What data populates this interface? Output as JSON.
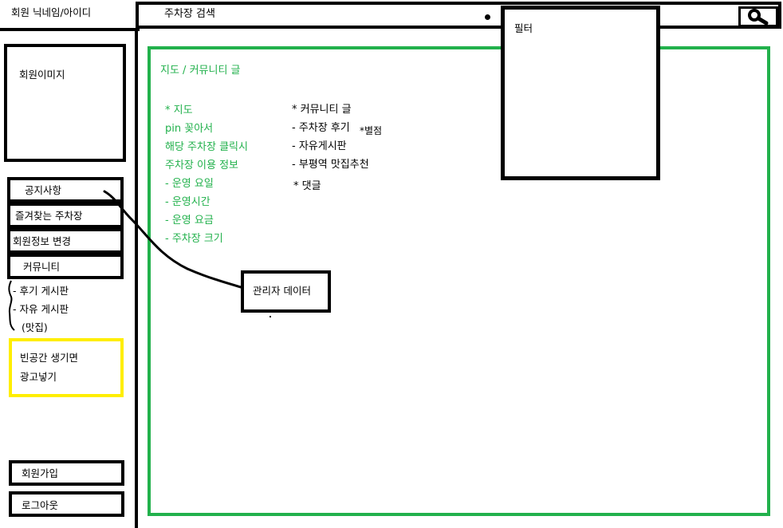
{
  "header": {
    "nickname": "회원 닉네임/아이디",
    "search_placeholder": "주차장 검색",
    "filter_label": "필터"
  },
  "sidebar": {
    "member_image": "회원이미지",
    "nav": [
      "공지사항",
      "즐겨찾는 주차장",
      "회원정보 변경",
      "커뮤니티"
    ],
    "community_sub": [
      "- 후기 게시판",
      "- 자유 게시판",
      "(맛집)"
    ],
    "ad": [
      "빈공간 생기면",
      "광고넣기"
    ],
    "join": "회원가입",
    "logout": "로그아웃"
  },
  "main": {
    "heading": "지도 / 커뮤니티 글",
    "map_lines": [
      "* 지도",
      "pin 꽂아서",
      "해당 주차장 클릭시",
      "주차장 이용 정보",
      "- 운영 요일",
      "- 운영시간",
      "- 운영 요금",
      "- 주차장 크기"
    ],
    "community_lines": [
      "* 커뮤니티 글",
      "- 주차장 후기",
      "- 자유게시판",
      "- 부평역 맛집추천",
      "* 댓글"
    ],
    "review_note": "*별점"
  },
  "admin_box": "관리자 데이터",
  "colors": {
    "main_border": "#22b14c",
    "ad_border": "#ffee00",
    "text_green": "#22b14c"
  },
  "icons": {
    "search": "search-icon"
  }
}
